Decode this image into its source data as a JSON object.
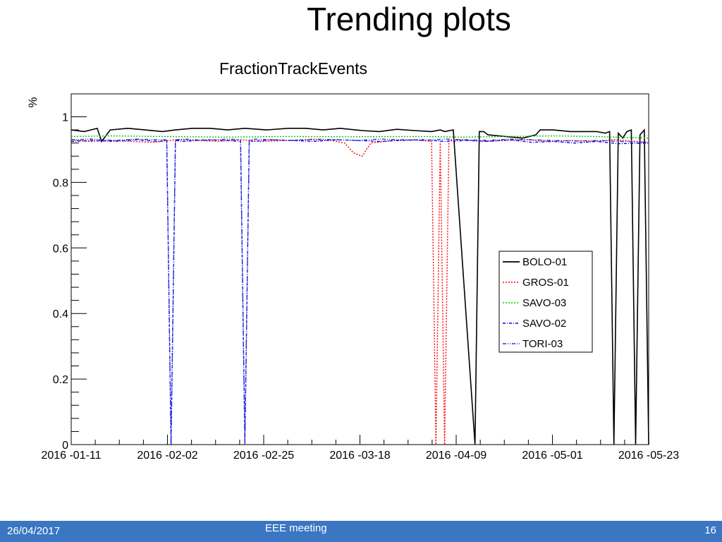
{
  "slide": {
    "title": "Trending plots",
    "footer": {
      "date": "26/04/2017",
      "center": "EEE meeting",
      "page": "16"
    }
  },
  "chart_data": {
    "type": "line",
    "title": "FractionTrackEvents",
    "xlabel": "",
    "ylabel": "%",
    "x_ticks": [
      "2016 -01-11",
      "2016 -02-02",
      "2016 -02-25",
      "2016 -03-18",
      "2016 -04-09",
      "2016 -05-01",
      "2016 -05-23"
    ],
    "x_range": [
      "2016-01-11",
      "2016-05-23"
    ],
    "ylim": [
      0,
      1.07
    ],
    "y_ticks": [
      0,
      0.2,
      0.4,
      0.6,
      0.8,
      1
    ],
    "y_tick_labels": [
      "0",
      "0.2",
      "0.4",
      "0.6",
      "0.8",
      "1"
    ],
    "grid": false,
    "legend": "right-middle",
    "series": [
      {
        "name": "BOLO-01",
        "color": "#000000",
        "style": "solid",
        "x": [
          "2016-01-11",
          "2016-01-14",
          "2016-01-17",
          "2016-01-18",
          "2016-01-20",
          "2016-01-24",
          "2016-01-28",
          "2016-02-01",
          "2016-02-04",
          "2016-02-08",
          "2016-02-12",
          "2016-02-16",
          "2016-02-20",
          "2016-02-25",
          "2016-03-01",
          "2016-03-05",
          "2016-03-09",
          "2016-03-13",
          "2016-03-18",
          "2016-03-22",
          "2016-03-26",
          "2016-03-30",
          "2016-04-03",
          "2016-04-05",
          "2016-04-06",
          "2016-04-08",
          "2016-04-13",
          "2016-04-14",
          "2016-04-15",
          "2016-04-16",
          "2016-04-20",
          "2016-04-24",
          "2016-04-27",
          "2016-04-28",
          "2016-05-01",
          "2016-05-05",
          "2016-05-09",
          "2016-05-11",
          "2016-05-13",
          "2016-05-14",
          "2016-05-15",
          "2016-05-16",
          "2016-05-17",
          "2016-05-18",
          "2016-05-19",
          "2016-05-20",
          "2016-05-21",
          "2016-05-22",
          "2016-05-23"
        ],
        "values": [
          0.96,
          0.955,
          0.965,
          0.925,
          0.96,
          0.965,
          0.96,
          0.955,
          0.96,
          0.965,
          0.965,
          0.96,
          0.965,
          0.96,
          0.965,
          0.965,
          0.96,
          0.965,
          0.958,
          0.955,
          0.962,
          0.958,
          0.955,
          0.96,
          0.955,
          0.96,
          0.0,
          0.955,
          0.955,
          0.945,
          0.94,
          0.935,
          0.945,
          0.96,
          0.96,
          0.955,
          0.955,
          0.955,
          0.95,
          0.955,
          0.0,
          0.95,
          0.935,
          0.955,
          0.96,
          0.0,
          0.945,
          0.96,
          0.0
        ]
      },
      {
        "name": "GROS-01",
        "color": "#ff0000",
        "style": "dotted",
        "x": [
          "2016-01-11",
          "2016-01-15",
          "2016-01-20",
          "2016-01-25",
          "2016-01-30",
          "2016-02-04",
          "2016-02-09",
          "2016-02-14",
          "2016-02-19",
          "2016-02-24",
          "2016-03-01",
          "2016-03-06",
          "2016-03-11",
          "2016-03-14",
          "2016-03-16",
          "2016-03-18",
          "2016-03-20",
          "2016-03-25",
          "2016-03-30",
          "2016-04-03",
          "2016-04-04",
          "2016-04-05",
          "2016-04-06",
          "2016-04-07",
          "2016-04-10",
          "2016-04-15",
          "2016-04-20",
          "2016-04-25",
          "2016-04-30",
          "2016-05-05",
          "2016-05-10",
          "2016-05-15",
          "2016-05-20",
          "2016-05-23"
        ],
        "values": [
          0.93,
          0.925,
          0.928,
          0.925,
          0.922,
          0.93,
          0.928,
          0.925,
          0.93,
          0.925,
          0.928,
          0.93,
          0.928,
          0.92,
          0.89,
          0.88,
          0.92,
          0.928,
          0.93,
          0.925,
          0.0,
          0.925,
          0.0,
          0.928,
          0.93,
          0.925,
          0.928,
          0.93,
          0.925,
          0.928,
          0.925,
          0.93,
          0.925,
          0.922
        ]
      },
      {
        "name": "SAVO-03",
        "color": "#00cc00",
        "style": "dotted",
        "x": [
          "2016-01-11",
          "2016-01-20",
          "2016-02-01",
          "2016-02-15",
          "2016-03-01",
          "2016-03-15",
          "2016-04-01",
          "2016-04-10",
          "2016-04-20",
          "2016-05-01",
          "2016-05-10",
          "2016-05-23"
        ],
        "values": [
          0.94,
          0.942,
          0.94,
          0.938,
          0.94,
          0.939,
          0.94,
          0.938,
          0.94,
          0.942,
          0.94,
          0.935
        ]
      },
      {
        "name": "SAVO-02",
        "color": "#0000ff",
        "style": "dashdot",
        "x": [
          "2016-01-11",
          "2016-01-16",
          "2016-01-21",
          "2016-01-26",
          "2016-01-31",
          "2016-02-02",
          "2016-02-03",
          "2016-02-04",
          "2016-02-06",
          "2016-02-11",
          "2016-02-16",
          "2016-02-19",
          "2016-02-20",
          "2016-02-21",
          "2016-02-22",
          "2016-02-26",
          "2016-03-02",
          "2016-03-07",
          "2016-03-12",
          "2016-03-17",
          "2016-03-22",
          "2016-03-27",
          "2016-04-01",
          "2016-04-06",
          "2016-04-11",
          "2016-04-16",
          "2016-04-21",
          "2016-04-26",
          "2016-05-01",
          "2016-05-06",
          "2016-05-11",
          "2016-05-16",
          "2016-05-23"
        ],
        "values": [
          0.925,
          0.928,
          0.925,
          0.93,
          0.925,
          0.928,
          0.0,
          0.928,
          0.925,
          0.93,
          0.928,
          0.925,
          0.0,
          0.928,
          0.925,
          0.93,
          0.928,
          0.925,
          0.93,
          0.928,
          0.925,
          0.928,
          0.93,
          0.925,
          0.928,
          0.925,
          0.93,
          0.922,
          0.925,
          0.92,
          0.925,
          0.918,
          0.92
        ]
      },
      {
        "name": "TORI-03",
        "color": "#3333cc",
        "style": "dashdotdot",
        "x": [
          "2016-01-11",
          "2016-01-16",
          "2016-01-21",
          "2016-01-26",
          "2016-01-31",
          "2016-02-02",
          "2016-02-03",
          "2016-02-04",
          "2016-02-06",
          "2016-02-11",
          "2016-02-16",
          "2016-02-19",
          "2016-02-20",
          "2016-02-21",
          "2016-02-22",
          "2016-02-26",
          "2016-03-02",
          "2016-03-07",
          "2016-03-12",
          "2016-03-17",
          "2016-03-22",
          "2016-03-27",
          "2016-04-01",
          "2016-04-06",
          "2016-04-11",
          "2016-04-16",
          "2016-04-21",
          "2016-04-26",
          "2016-05-01",
          "2016-05-06",
          "2016-05-11",
          "2016-05-16",
          "2016-05-23"
        ],
        "values": [
          0.93,
          0.932,
          0.928,
          0.932,
          0.93,
          0.93,
          0.0,
          0.93,
          0.932,
          0.928,
          0.932,
          0.93,
          0.0,
          0.93,
          0.932,
          0.93,
          0.928,
          0.932,
          0.93,
          0.928,
          0.932,
          0.93,
          0.928,
          0.932,
          0.93,
          0.928,
          0.932,
          0.93,
          0.928,
          0.926,
          0.928,
          0.925,
          0.922
        ]
      }
    ]
  }
}
